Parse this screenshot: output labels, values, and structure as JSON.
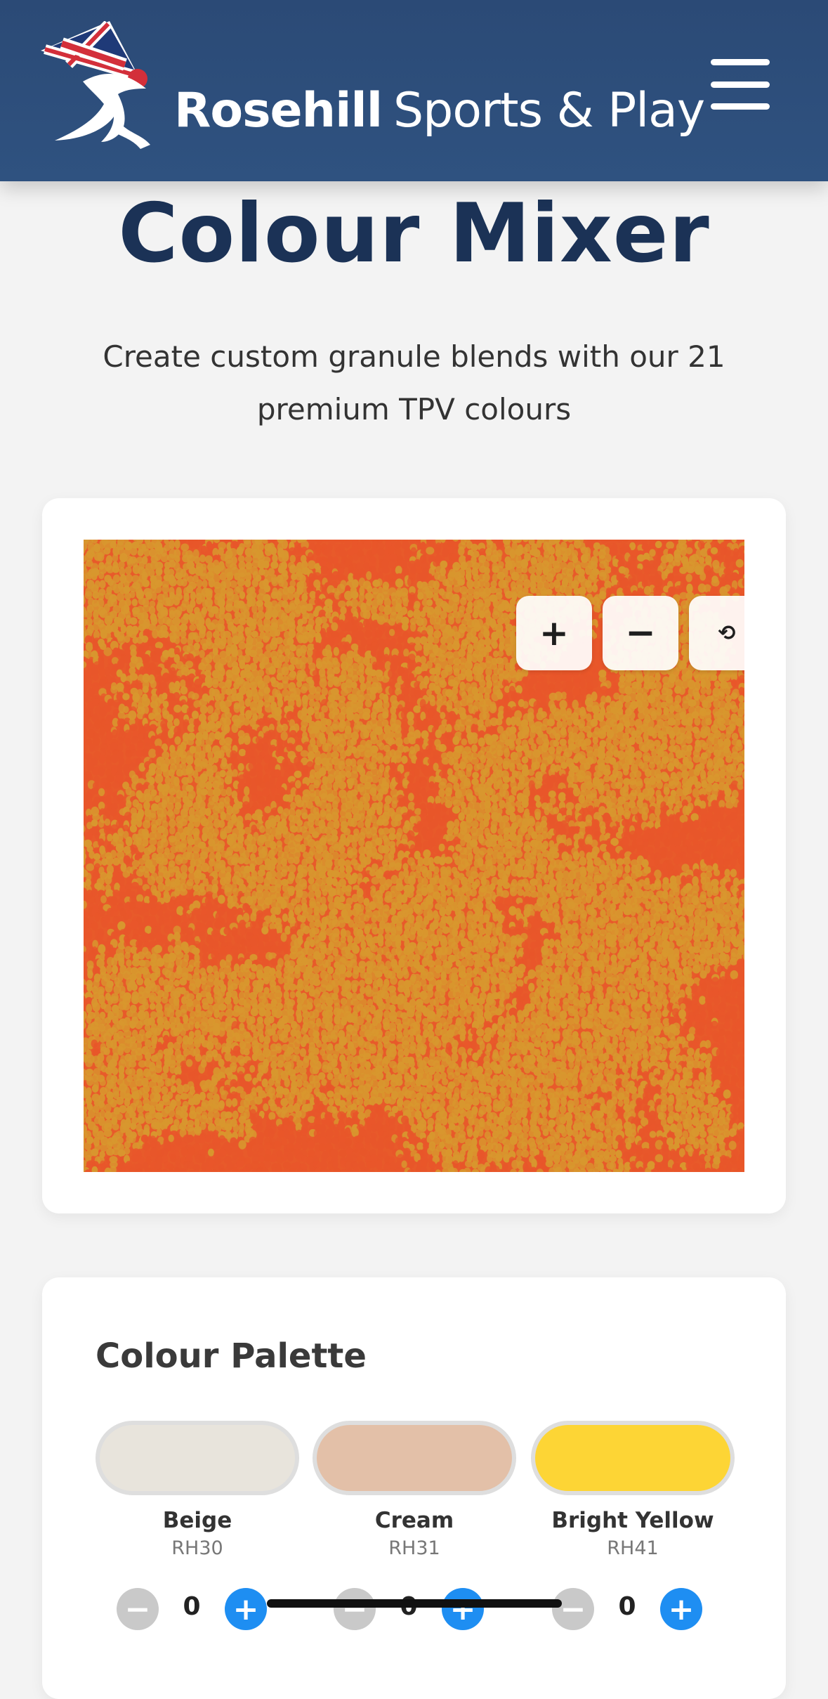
{
  "header": {
    "brand_bold": "Rosehill",
    "brand_light": "Sports & Play",
    "logo_icon": "union-jack-runner-logo",
    "menu_icon": "hamburger-menu-icon",
    "background": "#2d4d7a"
  },
  "page": {
    "title": "Colour Mixer",
    "subtitle": "Create custom granule blends with our 21 premium TPV colours"
  },
  "preview": {
    "blend_colours": [
      "#e8562a",
      "#d8972e"
    ],
    "controls": {
      "zoom_in": "+",
      "zoom_out": "−",
      "reset": "⟲"
    }
  },
  "palette": {
    "title": "Colour Palette",
    "swatches": [
      {
        "name": "Beige",
        "code": "RH30",
        "color": "#e8e4dc",
        "count": "0"
      },
      {
        "name": "Cream",
        "code": "RH31",
        "color": "#e3c0a8",
        "count": "0"
      },
      {
        "name": "Bright Yellow",
        "code": "RH41",
        "color": "#fdd535",
        "count": "0"
      }
    ],
    "minus_label": "−",
    "plus_label": "+"
  }
}
